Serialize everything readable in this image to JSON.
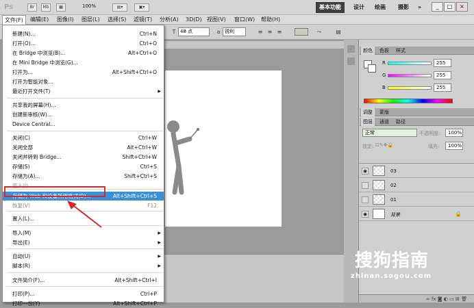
{
  "titlebar": {
    "logo": "Ps",
    "btns": [
      "Br",
      "Mb"
    ],
    "zoom": "100%",
    "workspaces": [
      "基本功能",
      "设计",
      "绘画",
      "摄影"
    ],
    "more": "»",
    "win_min": "_",
    "win_max": "□",
    "win_close": "×"
  },
  "menubar": {
    "items": [
      "文件(F)",
      "编辑(E)",
      "图像(I)",
      "图层(L)",
      "选择(S)",
      "滤镜(T)",
      "分析(A)",
      "3D(D)",
      "视图(V)",
      "窗口(W)",
      "帮助(H)"
    ]
  },
  "options": {
    "font_size": "48 点",
    "aa_label": "a",
    "aa_value": "锐利"
  },
  "file_menu": {
    "items": [
      {
        "label": "新建(N)...",
        "shortcut": "Ctrl+N"
      },
      {
        "label": "打开(O)...",
        "shortcut": "Ctrl+O"
      },
      {
        "label": "在 Bridge 中浏览(B)...",
        "shortcut": "Alt+Ctrl+O"
      },
      {
        "label": "在 Mini Bridge 中浏览(G)...",
        "shortcut": ""
      },
      {
        "label": "打开为...",
        "shortcut": "Alt+Shift+Ctrl+O"
      },
      {
        "label": "打开为智能对象...",
        "shortcut": ""
      },
      {
        "label": "最近打开文件(T)",
        "shortcut": ""
      },
      {
        "label": "共享我的屏幕(H)...",
        "shortcut": ""
      },
      {
        "label": "创建新审核(W)...",
        "shortcut": ""
      },
      {
        "label": "Device Central...",
        "shortcut": ""
      },
      {
        "label": "关闭(C)",
        "shortcut": "Ctrl+W"
      },
      {
        "label": "关闭全部",
        "shortcut": "Alt+Ctrl+W"
      },
      {
        "label": "关闭并转到 Bridge...",
        "shortcut": "Shift+Ctrl+W"
      },
      {
        "label": "存储(S)",
        "shortcut": "Ctrl+S"
      },
      {
        "label": "存储为(A)...",
        "shortcut": "Shift+Ctrl+S"
      },
      {
        "label": "签入(I)...",
        "shortcut": ""
      },
      {
        "label": "存储为 Web 和设备所用格式(D)...",
        "shortcut": "Alt+Shift+Ctrl+S"
      },
      {
        "label": "恢复(V)",
        "shortcut": "F12"
      },
      {
        "label": "置入(L)...",
        "shortcut": ""
      },
      {
        "label": "导入(M)",
        "shortcut": ""
      },
      {
        "label": "导出(E)",
        "shortcut": ""
      },
      {
        "label": "自动(U)",
        "shortcut": ""
      },
      {
        "label": "脚本(R)",
        "shortcut": ""
      },
      {
        "label": "文件简介(F)...",
        "shortcut": "Alt+Shift+Ctrl+I"
      },
      {
        "label": "打印(P)...",
        "shortcut": "Ctrl+P"
      },
      {
        "label": "打印一份(Y)",
        "shortcut": "Alt+Shift+Ctrl+P"
      }
    ]
  },
  "color_panel": {
    "tabs": [
      "颜色",
      "色板",
      "样式"
    ],
    "r_label": "R",
    "g_label": "G",
    "b_label": "B",
    "r": "255",
    "g": "255",
    "b": "255"
  },
  "adjust_panel": {
    "tabs": [
      "调整",
      "蒙版"
    ]
  },
  "layers_panel": {
    "tabs": [
      "图层",
      "通道",
      "路径"
    ],
    "blend_mode": "正常",
    "opacity_label": "不透明度:",
    "opacity": "100%",
    "lock_label": "锁定:",
    "fill_label": "填充:",
    "fill": "100%",
    "layers": [
      {
        "name": "03"
      },
      {
        "name": "02"
      },
      {
        "name": "01"
      },
      {
        "name": "背景"
      }
    ]
  },
  "watermark": {
    "text": "搜狗指南",
    "url": "zhinan.sogou.com"
  },
  "colors": {
    "highlight": "#3b8fd6",
    "annotation": "#d62828",
    "active_ws": "#3e3e3e"
  }
}
